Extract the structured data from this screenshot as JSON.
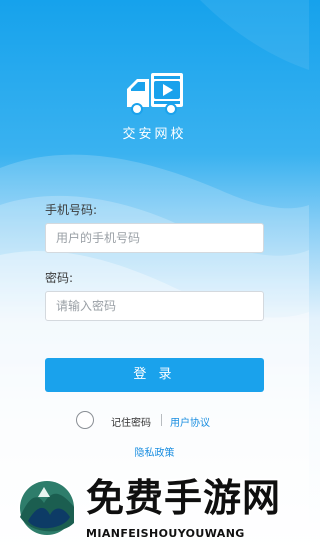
{
  "app": {
    "title": "交安网校"
  },
  "phone": {
    "label": "手机号码:",
    "placeholder": "用户的手机号码",
    "value": ""
  },
  "password": {
    "label": "密码:",
    "placeholder": "请输入密码",
    "value": ""
  },
  "login": {
    "label": "登 录"
  },
  "options": {
    "remember_label": "记住密码",
    "remember_checked": false,
    "agreement_label": "用户协议",
    "privacy_label": "隐私政策"
  },
  "watermark": {
    "text": "免费手游网",
    "subtext": "MIANFEISHOUYOUWANG"
  },
  "colors": {
    "primary": "#1aa2ec",
    "link": "#1a8ee0",
    "header_top": "#16a2ec"
  },
  "icons": {
    "logo": "truck-video-icon",
    "watermark": "mountain-logo-icon"
  }
}
